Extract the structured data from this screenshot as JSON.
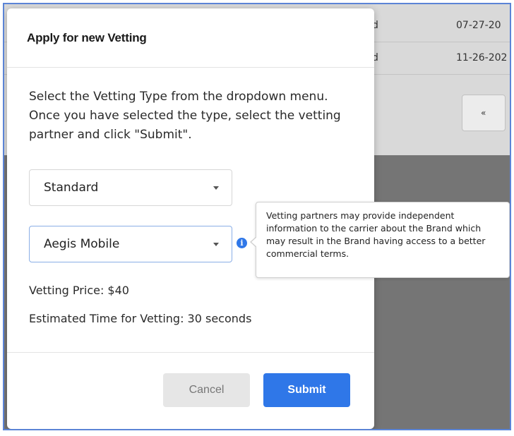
{
  "background": {
    "rows": [
      {
        "status": "d",
        "date": "07-27-20"
      },
      {
        "status": "d",
        "date": "11-26-202"
      }
    ],
    "pager_prev_label": "«"
  },
  "modal": {
    "title": "Apply for new Vetting",
    "intro": "Select the Vetting Type from the dropdown menu. Once you have selected the type, select the vetting partner and click \"Submit\".",
    "vetting_type": {
      "selected": "Standard"
    },
    "vetting_partner": {
      "selected": "Aegis Mobile"
    },
    "price": "Vetting Price: $40",
    "estimated_time": "Estimated Time for Vetting: 30 seconds",
    "cancel_label": "Cancel",
    "submit_label": "Submit"
  },
  "tooltip": {
    "text": "Vetting partners may provide independent information to the carrier about the Brand which may result in the Brand having access to a better commercial terms."
  },
  "colors": {
    "accent": "#2f77e8",
    "overlay": "#757575",
    "frame_border": "#5b84d6"
  },
  "icons": {
    "info": "info-icon",
    "dropdown": "chevron-down-icon"
  }
}
